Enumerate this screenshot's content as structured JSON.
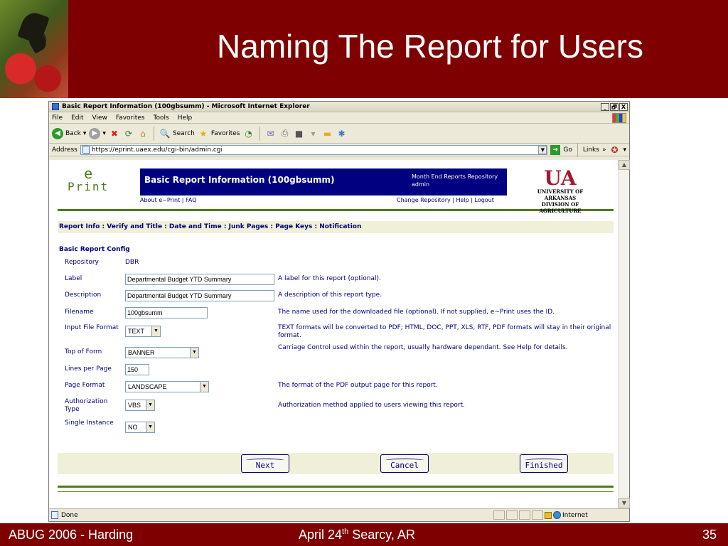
{
  "slide": {
    "title": "Naming The Report for Users",
    "footer_left": "ABUG 2006 - Harding",
    "footer_center_pre": "April 24",
    "footer_center_sup": "th",
    "footer_center_post": " Searcy, AR",
    "footer_right": "35"
  },
  "browser": {
    "window_title": "Basic Report Information (100gbsumm) - Microsoft Internet Explorer",
    "window_buttons": [
      "_",
      "🗗",
      "X"
    ],
    "menu": [
      "File",
      "Edit",
      "View",
      "Favorites",
      "Tools",
      "Help"
    ],
    "toolbar": {
      "back": "Back",
      "search": "Search",
      "favorites": "Favorites"
    },
    "address": {
      "label": "Address",
      "url": "https://eprint.uaex.edu/cgi-bin/admin.cgi",
      "go": "Go",
      "links": "Links"
    },
    "status": {
      "text": "Done",
      "zone": "Internet"
    }
  },
  "page": {
    "logo": {
      "e": "e",
      "print": "Print"
    },
    "header_title": "Basic Report Information (100gbsumm)",
    "repository_line": "Month End Reports Repository",
    "user_line": "admin",
    "about_links": "About e~Print | FAQ",
    "account_links": "Change Repository | Help | Logout",
    "ua_logo": "UA",
    "ua_line1": "UNIVERSITY OF ARKANSAS",
    "ua_line2": "DIVISION OF AGRICULTURE",
    "nav_breadcrumb": "Report Info : Verify and Title : Date and Time : Junk Pages : Page Keys : Notification",
    "section_title": "Basic Report Config",
    "fields": {
      "repository": {
        "label": "Repository",
        "value": "DBR"
      },
      "label": {
        "label": "Label",
        "value": "Departmental Budget YTD Summary",
        "help": "A label for this report (optional)."
      },
      "description": {
        "label": "Description",
        "value": "Departmental Budget YTD Summary",
        "help": "A description of this report type."
      },
      "filename": {
        "label": "Filename",
        "value": "100gbsumm",
        "help": "The name used for the downloaded file (optional). If not supplied, e~Print uses the ID."
      },
      "input_format": {
        "label": "Input File Format",
        "value": "TEXT",
        "help": "TEXT formats will be converted to PDF; HTML, DOC, PPT, XLS, RTF, PDF formats will stay in their original format."
      },
      "top_of_form": {
        "label": "Top of Form",
        "value": "BANNER",
        "help": "Carriage Control used within the report, usually hardware dependant. See Help for details."
      },
      "lines_per_page": {
        "label": "Lines per Page",
        "value": "150"
      },
      "page_format": {
        "label": "Page Format",
        "value": "LANDSCAPE",
        "help": "The format of the PDF output page for this report."
      },
      "auth_type": {
        "label": "Authorization Type",
        "value": "VBS",
        "help": "Authorization method applied to users viewing this report."
      },
      "single_instance": {
        "label": "Single Instance",
        "value": "NO"
      }
    },
    "buttons": {
      "next": "Next",
      "cancel": "Cancel",
      "finished": "Finished"
    }
  }
}
